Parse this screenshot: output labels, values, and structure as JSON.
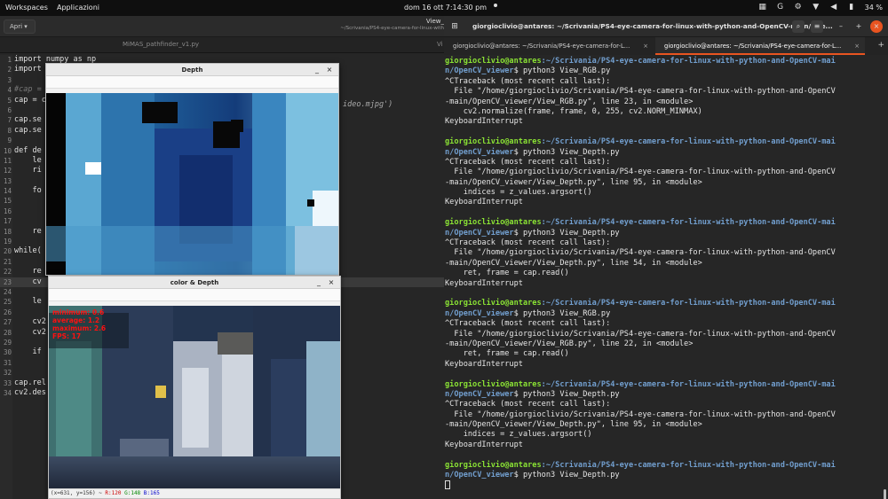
{
  "topbar": {
    "workspaces": "Workspaces",
    "apps": "Applicazioni",
    "clock": "dom 16 ott   7:14:30 pm",
    "battery": "34 %"
  },
  "editor": {
    "open_button": "Apri",
    "title": "View_",
    "subtitle": "~/Scrivania/PS4-eye-camera-for-linux-with",
    "tab1": "MiMAS_pathfinder_v1.py",
    "tab2": "Vi",
    "lines": [
      {
        "n": "1",
        "t": "import numpy as np"
      },
      {
        "n": "2",
        "t": "import"
      },
      {
        "n": "3",
        "t": ""
      },
      {
        "n": "4",
        "t": "#cap ="
      },
      {
        "n": "5",
        "t": "cap = c"
      },
      {
        "n": "6",
        "t": ""
      },
      {
        "n": "7",
        "t": "cap.se"
      },
      {
        "n": "8",
        "t": "cap.se"
      },
      {
        "n": "9",
        "t": ""
      },
      {
        "n": "10",
        "t": "def de"
      },
      {
        "n": "11",
        "t": "    le"
      },
      {
        "n": "12",
        "t": "    ri"
      },
      {
        "n": "13",
        "t": ""
      },
      {
        "n": "14",
        "t": "    fo"
      },
      {
        "n": "15",
        "t": ""
      },
      {
        "n": "16",
        "t": ""
      },
      {
        "n": "17",
        "t": ""
      },
      {
        "n": "18",
        "t": "    re"
      },
      {
        "n": "19",
        "t": ""
      },
      {
        "n": "20",
        "t": "while("
      },
      {
        "n": "21",
        "t": ""
      },
      {
        "n": "22",
        "t": "    re"
      },
      {
        "n": "23",
        "t": "    cv"
      },
      {
        "n": "24",
        "t": ""
      },
      {
        "n": "25",
        "t": "    le"
      },
      {
        "n": "26",
        "t": ""
      },
      {
        "n": "27",
        "t": "    cv2"
      },
      {
        "n": "28",
        "t": "    cv2"
      },
      {
        "n": "29",
        "t": ""
      },
      {
        "n": "30",
        "t": "    if"
      },
      {
        "n": "31",
        "t": ""
      },
      {
        "n": "32",
        "t": ""
      },
      {
        "n": "33",
        "t": "cap.rel"
      },
      {
        "n": "34",
        "t": "cv2.des"
      }
    ],
    "tail_text": "ideo.mjpg')"
  },
  "depth_window": {
    "title": "Depth",
    "min_label": "_",
    "close_label": "×"
  },
  "color_window": {
    "title": "color & Depth",
    "min_label": "_",
    "close_label": "×",
    "overlay": {
      "minimum": "minimum: 0.6",
      "average": "average: 1.2",
      "maximum": "maximum: 2.6",
      "fps": "FPS: 17"
    },
    "status": {
      "coords": "(x=631, y=156) ~ ",
      "r": "R:120",
      "g": "G:148",
      "b": "B:165"
    }
  },
  "terminal": {
    "title": "giorgioclivio@antares: ~/Scrivania/PS4-eye-camera-for-linux-with-python-and-OpenCV-main/Ope...",
    "tab1": "giorgioclivio@antares: ~/Scrivania/PS4-eye-camera-for-L...",
    "tab2": "giorgioclivio@antares: ~/Scrivania/PS4-eye-camera-for-L...",
    "prompt_user": "giorgioclivio@antares",
    "prompt_path1": ":~/Scrivania/PS4-eye-camera-for-linux-with-python-and-OpenCV-mai",
    "prompt_path2": "n/OpenCV_viewer",
    "blocks": [
      {
        "cmd": "$ python3 View_RGB.py",
        "lines": [
          "^CTraceback (most recent call last):",
          "  File \"/home/giorgioclivio/Scrivania/PS4-eye-camera-for-linux-with-python-and-OpenCV",
          "-main/OpenCV_viewer/View_RGB.py\", line 23, in <module>",
          "    cv2.normalize(frame, frame, 0, 255, cv2.NORM_MINMAX)",
          "KeyboardInterrupt"
        ]
      },
      {
        "cmd": "$ python3 View_Depth.py",
        "lines": [
          "^CTraceback (most recent call last):",
          "  File \"/home/giorgioclivio/Scrivania/PS4-eye-camera-for-linux-with-python-and-OpenCV",
          "-main/OpenCV_viewer/View_Depth.py\", line 95, in <module>",
          "    indices = z_values.argsort()",
          "KeyboardInterrupt"
        ]
      },
      {
        "cmd": "$ python3 View_Depth.py",
        "lines": [
          "^CTraceback (most recent call last):",
          "  File \"/home/giorgioclivio/Scrivania/PS4-eye-camera-for-linux-with-python-and-OpenCV",
          "-main/OpenCV_viewer/View_Depth.py\", line 54, in <module>",
          "    ret, frame = cap.read()",
          "KeyboardInterrupt"
        ]
      },
      {
        "cmd": "$ python3 View_RGB.py",
        "lines": [
          "^CTraceback (most recent call last):",
          "  File \"/home/giorgioclivio/Scrivania/PS4-eye-camera-for-linux-with-python-and-OpenCV",
          "-main/OpenCV_viewer/View_RGB.py\", line 22, in <module>",
          "    ret, frame = cap.read()",
          "KeyboardInterrupt"
        ]
      },
      {
        "cmd": "$ python3 View_Depth.py",
        "lines": [
          "^CTraceback (most recent call last):",
          "  File \"/home/giorgioclivio/Scrivania/PS4-eye-camera-for-linux-with-python-and-OpenCV",
          "-main/OpenCV_viewer/View_Depth.py\", line 95, in <module>",
          "    indices = z_values.argsort()",
          "KeyboardInterrupt"
        ]
      }
    ],
    "last_cmd": "$ python3 View_Depth.py"
  },
  "colors": {
    "accent": "#e95420",
    "prompt_user": "#8ae234",
    "prompt_path": "#729fcf"
  }
}
